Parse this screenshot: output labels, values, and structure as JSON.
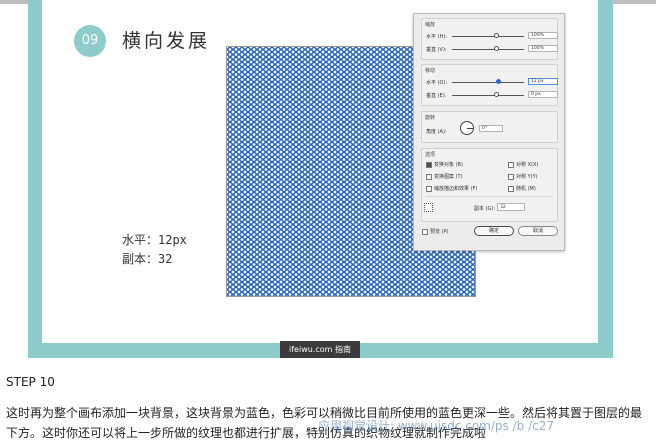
{
  "tutorial": {
    "step_number": "09",
    "step_title": "横向发展",
    "note_horizontal": "水平：12px",
    "note_copies": "副本：32"
  },
  "dialog": {
    "scale": {
      "title": "缩放",
      "horizontal_label": "水平 (H):",
      "horizontal_value": "100%",
      "vertical_label": "垂直 (V):",
      "vertical_value": "100%"
    },
    "move": {
      "title": "移动",
      "horizontal_label": "水平 (O):",
      "horizontal_value": "12 px",
      "vertical_label": "垂直 (E):",
      "vertical_value": "0 px"
    },
    "rotate": {
      "title": "旋转",
      "angle_label": "角度 (A):",
      "angle_value": "0°"
    },
    "options": {
      "title": "选项",
      "transform_objects": "变换对象 (B)",
      "transform_patterns": "变换图案 (T)",
      "scale_strokes": "缩放描边和效果 (F)",
      "reflect_x": "对称 X(X)",
      "reflect_y": "对称 Y(Y)",
      "random": "随机 (M)",
      "copies_label": "副本 (G):",
      "copies_value": "32"
    },
    "preview_label": "预览 (P)",
    "ok_label": "确定",
    "cancel_label": "取消"
  },
  "watermark": {
    "badge_text": "ifeiwu.com 指南",
    "overlay_text": "应用视觉设计: www.uisdc.com/ps  /b  /c27"
  },
  "article": {
    "step_heading": "STEP 10",
    "paragraph": "这时再为整个画布添加一块背景，这块背景为蓝色，色彩可以稍微比目前所使用的蓝色更深一些。然后将其置于图层的最下方。这时你还可以将上一步所做的纹理也都进行扩展，特别仿真的织物纹理就制作完成啦"
  },
  "colors": {
    "teal_frame": "#8ecccb",
    "pattern_blue": "#1f5fbf"
  }
}
